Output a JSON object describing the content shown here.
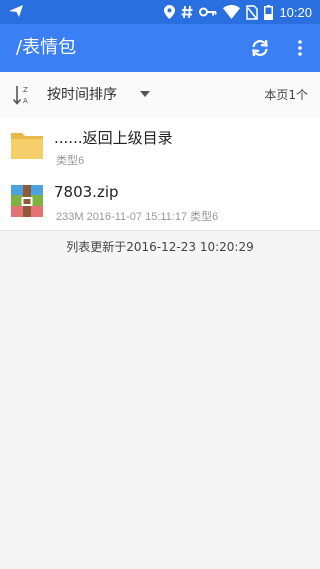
{
  "status_bar": {
    "time": "10:20",
    "icons": [
      "navigation-icon",
      "location-icon",
      "hash-icon",
      "key-icon",
      "wifi-icon",
      "no-sim-icon",
      "battery-icon"
    ]
  },
  "app_bar": {
    "title": "/表情包",
    "background": "#3a7ff3"
  },
  "sort_bar": {
    "sort_label": "按时间排序",
    "page_count": "本页1个"
  },
  "files": [
    {
      "name": "......返回上级目录",
      "meta": "类型6",
      "icon": "folder-icon"
    },
    {
      "name": "7803.zip",
      "meta": "233M 2016-11-07 15:11:17 类型6",
      "icon": "zip-archive-icon"
    }
  ],
  "footer": {
    "updated": "列表更新于2016-12-23 10:20:29"
  }
}
